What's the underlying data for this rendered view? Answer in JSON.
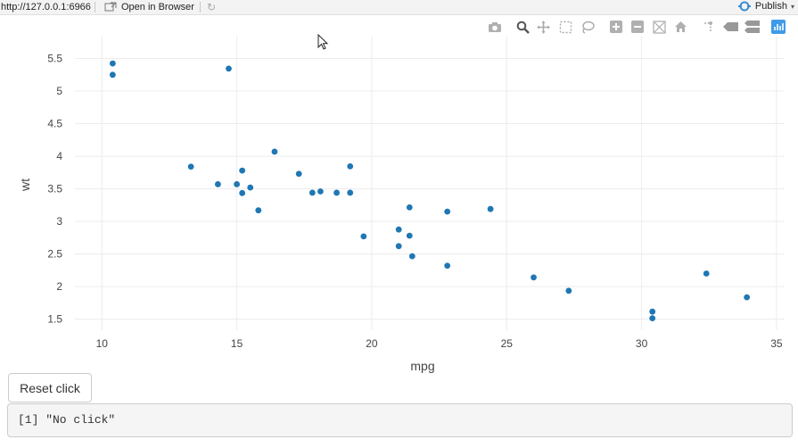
{
  "topbar": {
    "url": "http://127.0.0.1:6966",
    "open_label": "Open in Browser",
    "publish_label": "Publish"
  },
  "modebar": {
    "icons": [
      "camera-icon",
      "zoom-icon",
      "pan-icon",
      "box-select-icon",
      "lasso-select-icon",
      "zoom-in-icon",
      "zoom-out-icon",
      "autoscale-icon",
      "reset-axes-icon",
      "spike-lines-icon",
      "hover-closest-icon",
      "hover-compare-icon",
      "plotly-logo-icon"
    ]
  },
  "chart_data": {
    "type": "scatter",
    "title": "",
    "xlabel": "mpg",
    "ylabel": "wt",
    "xlim": [
      9.0,
      35.3
    ],
    "ylim": [
      1.33,
      5.85
    ],
    "xticks": [
      10,
      15,
      20,
      25,
      30,
      35
    ],
    "yticks": [
      1.5,
      2,
      2.5,
      3,
      3.5,
      4,
      4.5,
      5,
      5.5
    ],
    "ytick_labels": [
      "1.5",
      "2",
      "2.5",
      "3",
      "3.5",
      "4",
      "4.5",
      "5",
      "5.5"
    ],
    "grid": true,
    "marker_color": "#1f77b4",
    "points": [
      [
        21.0,
        2.62
      ],
      [
        21.0,
        2.875
      ],
      [
        22.8,
        2.32
      ],
      [
        21.4,
        3.215
      ],
      [
        18.7,
        3.44
      ],
      [
        18.1,
        3.46
      ],
      [
        14.3,
        3.57
      ],
      [
        24.4,
        3.19
      ],
      [
        22.8,
        3.15
      ],
      [
        19.2,
        3.44
      ],
      [
        17.8,
        3.44
      ],
      [
        16.4,
        4.07
      ],
      [
        17.3,
        3.73
      ],
      [
        15.2,
        3.78
      ],
      [
        10.4,
        5.25
      ],
      [
        10.4,
        5.424
      ],
      [
        14.7,
        5.345
      ],
      [
        32.4,
        2.2
      ],
      [
        30.4,
        1.615
      ],
      [
        33.9,
        1.835
      ],
      [
        21.5,
        2.465
      ],
      [
        15.5,
        3.52
      ],
      [
        15.2,
        3.435
      ],
      [
        13.3,
        3.84
      ],
      [
        19.2,
        3.845
      ],
      [
        27.3,
        1.935
      ],
      [
        26.0,
        2.14
      ],
      [
        30.4,
        1.513
      ],
      [
        15.8,
        3.17
      ],
      [
        19.7,
        2.77
      ],
      [
        15.0,
        3.57
      ],
      [
        21.4,
        2.78
      ]
    ]
  },
  "controls": {
    "reset_label": "Reset click",
    "output_text": "[1] \"No click\""
  }
}
